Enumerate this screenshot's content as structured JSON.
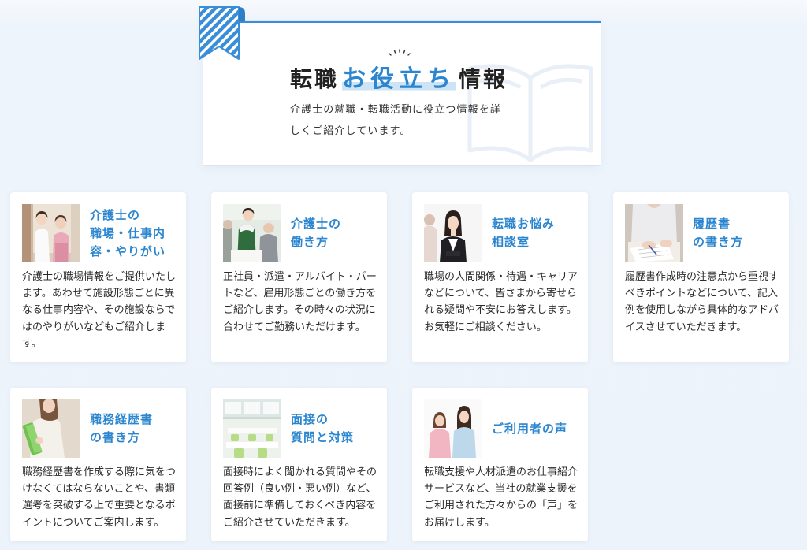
{
  "header": {
    "title_part1": "転職",
    "title_highlight": "お役立ち",
    "title_part2": "情報",
    "lead_lines": [
      "介護士の就職・転職活動に役立つ情報を詳",
      "しくご紹介しています。"
    ]
  },
  "cards": [
    {
      "title_lines": [
        "介護士の",
        "職場・仕事内",
        "容・やりがい"
      ],
      "desc_lines": [
        "介護士の職場情報をご提供いたし",
        "ます。あわせて施設形態ごとに異",
        "なる仕事内容や、その施設ならで",
        "はのやりがいなどもご紹介しま",
        "す。"
      ]
    },
    {
      "title_lines": [
        "介護士の",
        "働き方"
      ],
      "desc_lines": [
        "正社員・派遣・アルバイト・パー",
        "トなど、雇用形態ごとの働き方を",
        "ご紹介します。その時々の状況に",
        "合わせてご勤務いただけます。"
      ]
    },
    {
      "title_lines": [
        "転職お悩み",
        "相談室"
      ],
      "desc_lines": [
        "職場の人間関係・待遇・キャリア",
        "などについて、皆さまから寄せら",
        "れる疑問や不安にお答えします。",
        "お気軽にご相談ください。"
      ]
    },
    {
      "title_lines": [
        "履歴書",
        "の書き方"
      ],
      "desc_lines": [
        "履歴書作成時の注意点から重視す",
        "べきポイントなどについて、記入",
        "例を使用しながら具体的なアドバ",
        "イスさせていただきます。"
      ]
    },
    {
      "title_lines": [
        "職務経歴書",
        "の書き方"
      ],
      "desc_lines": [
        "職務経歴書を作成する際に気をつ",
        "けなくてはならないことや、書類",
        "選考を突破する上で重要となるポ",
        "イントについてご案内します。"
      ]
    },
    {
      "title_lines": [
        "面接の",
        "質問と対策"
      ],
      "desc_lines": [
        "面接時によく聞かれる質問やその",
        "回答例（良い例・悪い例）など、",
        "面接前に準備しておくべき内容を",
        "ご紹介させていただきます。"
      ]
    },
    {
      "title_lines": [
        "ご利用者の声"
      ],
      "desc_lines": [
        "転職支援や人材派遣のお仕事紹介",
        "サービスなど、当社の就業支援を",
        "ご利用された方々からの「声」を",
        "お届けします。"
      ]
    }
  ],
  "colors": {
    "accent": "#2b86cf",
    "ribbon": "#3a8ed8",
    "highlight": "#cde4f6",
    "page_background": "#eef4fb",
    "card_background": "#ffffff",
    "text": "#2b2b2b"
  },
  "icons": {
    "ribbon": "bookmark-ribbon-icon",
    "sparkle": "sparkle-icon",
    "book": "open-book-icon"
  }
}
